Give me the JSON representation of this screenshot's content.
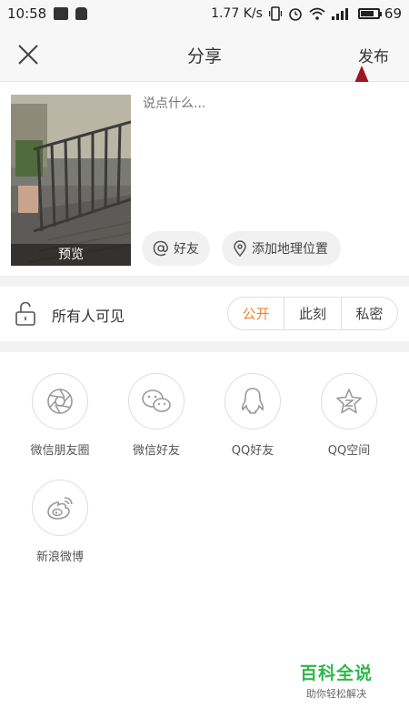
{
  "status_bar": {
    "time": "10:58",
    "speed": "1.77 K/s",
    "battery": "69"
  },
  "nav": {
    "title": "分享",
    "publish_label": "发布"
  },
  "compose": {
    "placeholder": "说点什么...",
    "photo_label": "预览",
    "mention_label": "好友",
    "location_label": "添加地理位置"
  },
  "privacy": {
    "label": "所有人可见",
    "options": [
      "公开",
      "此刻",
      "私密"
    ],
    "selected": "公开"
  },
  "share_targets": [
    {
      "label": "微信朋友圈",
      "icon": "wechat-moments-icon"
    },
    {
      "label": "微信好友",
      "icon": "wechat-icon"
    },
    {
      "label": "QQ好友",
      "icon": "qq-icon"
    },
    {
      "label": "QQ空间",
      "icon": "qzone-icon"
    },
    {
      "label": "新浪微博",
      "icon": "weibo-icon"
    }
  ],
  "watermark": {
    "title": "百科全说",
    "subtitle": "助你轻松解决"
  },
  "colors": {
    "accent": "#f2862e",
    "arrow": "#a0151c",
    "watermark": "#2db84a"
  }
}
